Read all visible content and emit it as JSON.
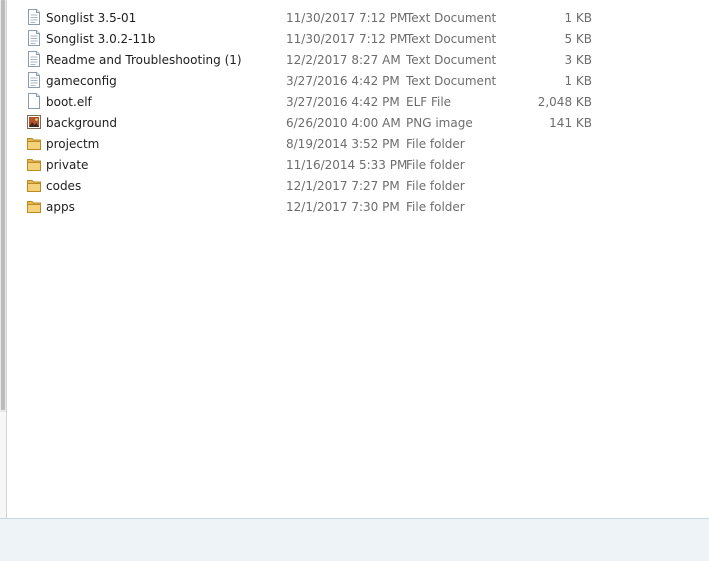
{
  "files": [
    {
      "name": "Songlist 3.5-01",
      "date": "11/30/2017 7:12 PM",
      "type": "Text Document",
      "size": "1 KB",
      "icon": "text-document-icon"
    },
    {
      "name": "Songlist 3.0.2-11b",
      "date": "11/30/2017 7:12 PM",
      "type": "Text Document",
      "size": "5 KB",
      "icon": "text-document-icon"
    },
    {
      "name": "Readme and Troubleshooting (1)",
      "date": "12/2/2017 8:27 AM",
      "type": "Text Document",
      "size": "3 KB",
      "icon": "text-document-icon"
    },
    {
      "name": "gameconfig",
      "date": "3/27/2016 4:42 PM",
      "type": "Text Document",
      "size": "1 KB",
      "icon": "text-document-icon"
    },
    {
      "name": "boot.elf",
      "date": "3/27/2016 4:42 PM",
      "type": "ELF File",
      "size": "2,048 KB",
      "icon": "blank-file-icon"
    },
    {
      "name": "background",
      "date": "6/26/2010 4:00 AM",
      "type": "PNG image",
      "size": "141 KB",
      "icon": "png-image-icon"
    },
    {
      "name": "projectm",
      "date": "8/19/2014 3:52 PM",
      "type": "File folder",
      "size": "",
      "icon": "folder-icon"
    },
    {
      "name": "private",
      "date": "11/16/2014 5:33 PM",
      "type": "File folder",
      "size": "",
      "icon": "folder-icon"
    },
    {
      "name": "codes",
      "date": "12/1/2017 7:27 PM",
      "type": "File folder",
      "size": "",
      "icon": "folder-icon"
    },
    {
      "name": "apps",
      "date": "12/1/2017 7:30 PM",
      "type": "File folder",
      "size": "",
      "icon": "folder-icon"
    }
  ],
  "colors": {
    "folder": "#e8b84a",
    "document_border": "#8a9bb0",
    "secondary_text": "#6d6d6d"
  }
}
